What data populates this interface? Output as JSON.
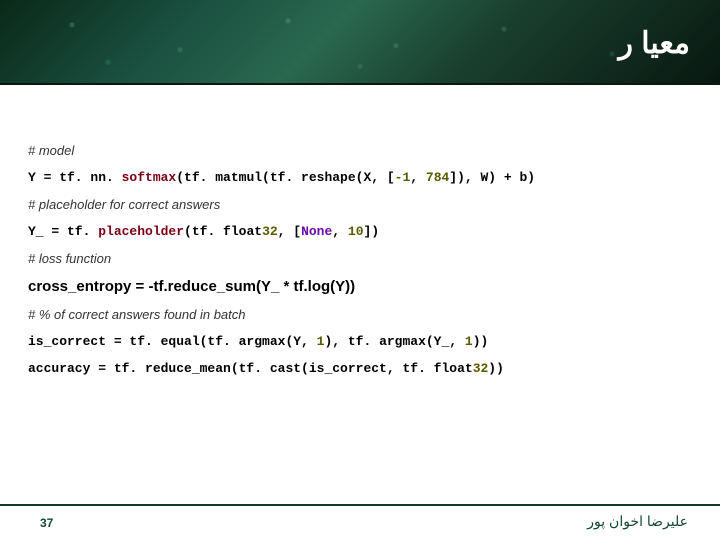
{
  "header": {
    "title": "ﻣﻌﯿﺎ ﺭ"
  },
  "lines": {
    "c1": "# model",
    "l1a": "Y = tf. nn. ",
    "l1b": "softmax",
    "l1c": "(tf. matmul(tf. reshape(X, [",
    "l1d": "-1",
    "l1e": ", ",
    "l1f": "784",
    "l1g": "]), W) + b)",
    "c2": "# placeholder for correct answers",
    "l2a": "Y_ = tf. ",
    "l2b": "placeholder",
    "l2c": "(tf. float",
    "l2d": "32",
    "l2e": ", [",
    "l2f": "None",
    "l2g": ", ",
    "l2h": "10",
    "l2i": "])",
    "c3": "# loss function",
    "l3": "cross_entropy = -tf.reduce_sum(Y_ * tf.log(Y))",
    "c4": "# % of correct answers found in batch",
    "l4a": "is_correct = tf. equal(tf. argmax(Y, ",
    "l4b": "1",
    "l4c": "), tf. argmax(Y_, ",
    "l4d": "1",
    "l4e": "))",
    "l5a": "accuracy = tf. reduce_mean(tf. cast(is_correct, tf. float",
    "l5b": "32",
    "l5c": "))"
  },
  "footer": {
    "slide_number": "37",
    "author": "ﻋﻠﯿﺮﺿﺎ ﺍﺧﻮﺍﻥ ﭘﻮﺭ"
  }
}
